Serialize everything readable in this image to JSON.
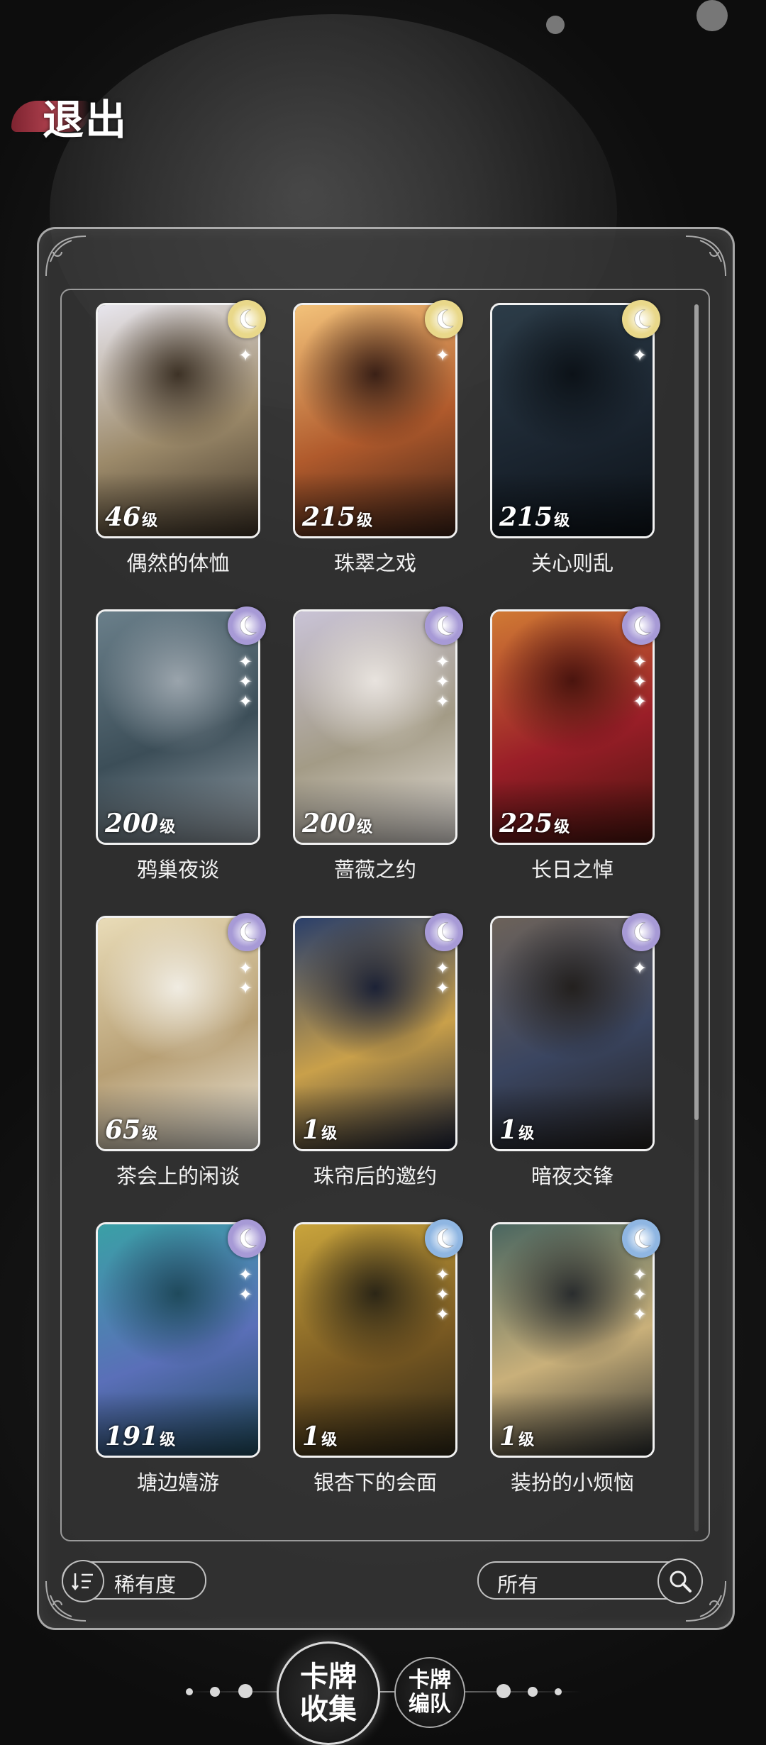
{
  "header": {
    "exit_label": "退出"
  },
  "cards": [
    {
      "name": "偶然的体恤",
      "level": "46",
      "level_unit": "级",
      "rarity": "gold",
      "stars": 1,
      "art": [
        "#e8e6ee",
        "#9c8a6a",
        "#3d3226"
      ]
    },
    {
      "name": "珠翠之戏",
      "level": "215",
      "level_unit": "级",
      "rarity": "gold",
      "stars": 1,
      "art": [
        "#f3c27a",
        "#b05a2c",
        "#3a2016"
      ]
    },
    {
      "name": "关心则乱",
      "level": "215",
      "level_unit": "级",
      "rarity": "gold",
      "stars": 1,
      "art": [
        "#2c3c48",
        "#1b2530",
        "#0c1218"
      ]
    },
    {
      "name": "鸦巢夜谈",
      "level": "200",
      "level_unit": "级",
      "rarity": "purple",
      "stars": 3,
      "art": [
        "#6a7f8a",
        "#3c4e58",
        "#9aa4ac"
      ]
    },
    {
      "name": "蔷薇之约",
      "level": "200",
      "level_unit": "级",
      "rarity": "purple",
      "stars": 3,
      "art": [
        "#c9c3d6",
        "#a39b86",
        "#e8e3de"
      ]
    },
    {
      "name": "长日之悼",
      "level": "225",
      "level_unit": "级",
      "rarity": "purple",
      "stars": 3,
      "art": [
        "#d07a34",
        "#9a1e28",
        "#4a140e"
      ]
    },
    {
      "name": "茶会上的闲谈",
      "level": "65",
      "level_unit": "级",
      "rarity": "purple",
      "stars": 2,
      "art": [
        "#e9dcb8",
        "#b79f74",
        "#f0ece2"
      ]
    },
    {
      "name": "珠帘后的邀约",
      "level": "1",
      "level_unit": "级",
      "rarity": "purple",
      "stars": 2,
      "art": [
        "#2a3f6a",
        "#c9a04a",
        "#1c2236"
      ]
    },
    {
      "name": "暗夜交锋",
      "level": "1",
      "level_unit": "级",
      "rarity": "purple",
      "stars": 1,
      "art": [
        "#6c625a",
        "#3a4560",
        "#23201e"
      ]
    },
    {
      "name": "塘边嬉游",
      "level": "191",
      "level_unit": "级",
      "rarity": "purple",
      "stars": 2,
      "art": [
        "#3aa0a6",
        "#5a6fb8",
        "#1f4a5c"
      ]
    },
    {
      "name": "银杏下的会面",
      "level": "1",
      "level_unit": "级",
      "rarity": "blue",
      "stars": 3,
      "art": [
        "#c9a43c",
        "#7a5a22",
        "#2c2616"
      ]
    },
    {
      "name": "装扮的小烦恼",
      "level": "1",
      "level_unit": "级",
      "rarity": "blue",
      "stars": 3,
      "art": [
        "#4a6660",
        "#c9b07a",
        "#2a2d2e"
      ]
    }
  ],
  "controls": {
    "sort_label": "稀有度",
    "filter_label": "所有"
  },
  "bottom_nav": {
    "collection_label": "卡牌收集",
    "team_label": "卡牌编队"
  },
  "colors": {
    "rarity_gold": "#e9d88a",
    "rarity_purple": "#a79ad6",
    "rarity_blue": "#8fb6e2"
  }
}
